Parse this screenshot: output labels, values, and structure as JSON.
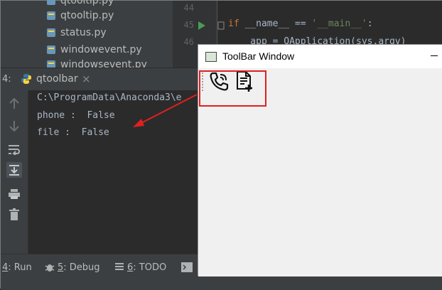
{
  "project_tree": {
    "items": [
      "qtooltip.py",
      "qtooltip.py",
      "status.py",
      "windowevent.py",
      "windowsevent.py"
    ]
  },
  "editor": {
    "line_numbers": [
      "44",
      "45",
      "46"
    ],
    "code_line_45": {
      "kw_if": "if",
      "name": " __name__ == ",
      "str": "'__main__'",
      "colon": ":"
    },
    "code_line_46": "    app = QApplication(sys.argv)"
  },
  "run_panel": {
    "tab_prefix": "4:",
    "tab_label": "qtoolbar",
    "tab_close": "×"
  },
  "console": {
    "lines": [
      "C:\\ProgramData\\Anaconda3\\e",
      "phone :  False",
      "file :  False"
    ]
  },
  "bottom_tabs": [
    {
      "key": "4",
      "label": ": Run"
    },
    {
      "key": "5",
      "label": ": Debug"
    },
    {
      "key": "6",
      "label": ": TODO"
    }
  ],
  "qt_window": {
    "title": "ToolBar Window",
    "toolbar_actions": [
      "phone",
      "file"
    ]
  },
  "colors": {
    "highlight": "#e02020"
  }
}
